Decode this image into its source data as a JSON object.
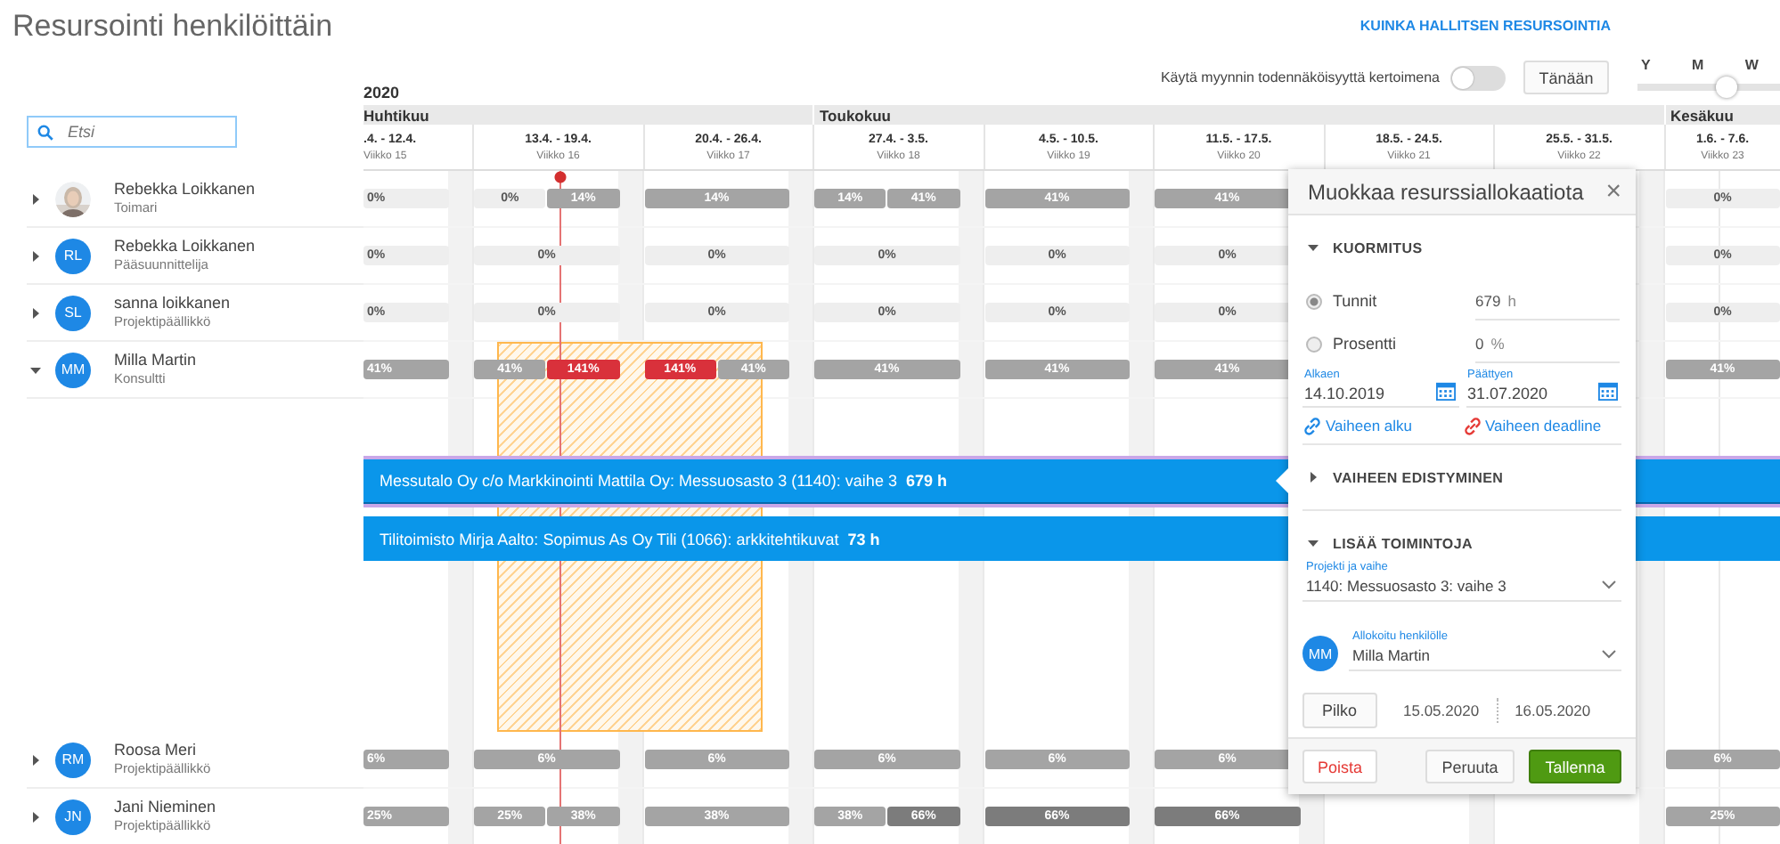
{
  "title": "Resursointi henkilöittäin",
  "help_link": "KUINKA HALLITSEN RESURSOINTIA",
  "probability_toggle": {
    "label": "Käytä myynnin todennäköisyyttä kertoimena",
    "on": false
  },
  "today_button": "Tänään",
  "zoom": {
    "labels": [
      "Y",
      "M",
      "W"
    ],
    "level": 0.62
  },
  "search": {
    "placeholder": "Etsi"
  },
  "year": "2020",
  "months": [
    {
      "name": "Huhtikuu",
      "weeks": [
        {
          "dates": ".4. - 12.4.",
          "week": "Viikko 15"
        },
        {
          "dates": "13.4. - 19.4.",
          "week": "Viikko 16"
        },
        {
          "dates": "20.4. - 26.4.",
          "week": "Viikko 17"
        }
      ]
    },
    {
      "name": "Toukokuu",
      "weeks": [
        {
          "dates": "27.4. - 3.5.",
          "week": "Viikko 18"
        },
        {
          "dates": "4.5. - 10.5.",
          "week": "Viikko 19"
        },
        {
          "dates": "11.5. - 17.5.",
          "week": "Viikko 20"
        },
        {
          "dates": "18.5. - 24.5.",
          "week": "Viikko 21"
        },
        {
          "dates": "25.5. - 31.5.",
          "week": "Viikko 22"
        }
      ]
    },
    {
      "name": "Kesäkuu",
      "weeks": [
        {
          "dates": "1.6. - 7.6.",
          "week": "Viikko 23"
        }
      ]
    }
  ],
  "people": [
    {
      "name": "Rebekka Loikkanen",
      "role": "Toimari",
      "avatar": {
        "kind": "picture"
      },
      "expanded": false,
      "weeks": [
        [
          {
            "label": "0%",
            "kind": "empty"
          }
        ],
        [
          {
            "label": "0%",
            "kind": "empty"
          },
          {
            "label": "14%",
            "kind": "normal"
          }
        ],
        [
          {
            "label": "14%",
            "kind": "normal"
          }
        ],
        [
          {
            "label": "14%",
            "kind": "normal"
          },
          {
            "label": "41%",
            "kind": "normal"
          }
        ],
        [
          {
            "label": "41%",
            "kind": "normal"
          }
        ],
        [
          {
            "label": "41%",
            "kind": "normal"
          }
        ],
        [
          {
            "label": "0%",
            "kind": "empty"
          }
        ]
      ]
    },
    {
      "name": "Rebekka Loikkanen",
      "role": "Pääsuunnittelija",
      "avatar": {
        "kind": "initials",
        "text": "RL"
      },
      "expanded": false,
      "weeks": [
        [
          {
            "label": "0%",
            "kind": "empty"
          }
        ],
        [
          {
            "label": "0%",
            "kind": "empty"
          }
        ],
        [
          {
            "label": "0%",
            "kind": "empty"
          }
        ],
        [
          {
            "label": "0%",
            "kind": "empty"
          }
        ],
        [
          {
            "label": "0%",
            "kind": "empty"
          }
        ],
        [
          {
            "label": "0%",
            "kind": "empty"
          }
        ],
        [
          {
            "label": "0%",
            "kind": "empty"
          }
        ]
      ]
    },
    {
      "name": "sanna loikkanen",
      "role": "Projektipäällikkö",
      "avatar": {
        "kind": "initials",
        "text": "SL"
      },
      "expanded": false,
      "weeks": [
        [
          {
            "label": "0%",
            "kind": "empty"
          }
        ],
        [
          {
            "label": "0%",
            "kind": "empty"
          }
        ],
        [
          {
            "label": "0%",
            "kind": "empty"
          }
        ],
        [
          {
            "label": "0%",
            "kind": "empty"
          }
        ],
        [
          {
            "label": "0%",
            "kind": "empty"
          }
        ],
        [
          {
            "label": "0%",
            "kind": "empty"
          }
        ],
        [
          {
            "label": "0%",
            "kind": "empty"
          }
        ]
      ]
    },
    {
      "name": "Milla Martin",
      "role": "Konsultti",
      "avatar": {
        "kind": "initials",
        "text": "MM"
      },
      "expanded": true,
      "weeks": [
        [
          {
            "label": "41%",
            "kind": "normal"
          }
        ],
        [
          {
            "label": "41%",
            "kind": "normal"
          },
          {
            "label": "141%",
            "kind": "over"
          }
        ],
        [
          {
            "label": "141%",
            "kind": "over"
          },
          {
            "label": "41%",
            "kind": "normal"
          }
        ],
        [
          {
            "label": "41%",
            "kind": "normal"
          }
        ],
        [
          {
            "label": "41%",
            "kind": "normal"
          }
        ],
        [
          {
            "label": "41%",
            "kind": "normal"
          }
        ],
        [
          {
            "label": "41%",
            "kind": "normal"
          }
        ]
      ],
      "allocations": [
        {
          "text": "Messutalo Oy c/o Markkinointi Mattila Oy: Messuosasto 3 (1140): vaihe 3  **679 h**",
          "selected": true
        },
        {
          "text": "Tilitoimisto Mirja Aalto: Sopimus As Oy Tili (1066): arkkitehtikuvat  **73 h**",
          "selected": false
        }
      ]
    },
    {
      "name": "Roosa Meri",
      "role": "Projektipäällikkö",
      "avatar": {
        "kind": "initials",
        "text": "RM"
      },
      "expanded": false,
      "weeks": [
        [
          {
            "label": "6%",
            "kind": "normal"
          }
        ],
        [
          {
            "label": "6%",
            "kind": "normal"
          }
        ],
        [
          {
            "label": "6%",
            "kind": "normal"
          }
        ],
        [
          {
            "label": "6%",
            "kind": "normal"
          }
        ],
        [
          {
            "label": "6%",
            "kind": "normal"
          }
        ],
        [
          {
            "label": "6%",
            "kind": "normal"
          }
        ],
        [
          {
            "label": "6%",
            "kind": "normal"
          }
        ]
      ]
    },
    {
      "name": "Jani Nieminen",
      "role": "Projektipäällikkö",
      "avatar": {
        "kind": "initials",
        "text": "JN"
      },
      "expanded": false,
      "weeks": [
        [
          {
            "label": "25%",
            "kind": "normal"
          }
        ],
        [
          {
            "label": "25%",
            "kind": "normal"
          },
          {
            "label": "38%",
            "kind": "normal"
          }
        ],
        [
          {
            "label": "38%",
            "kind": "normal"
          }
        ],
        [
          {
            "label": "38%",
            "kind": "normal"
          },
          {
            "label": "66%",
            "kind": "dark"
          }
        ],
        [
          {
            "label": "66%",
            "kind": "dark"
          }
        ],
        [
          {
            "label": "66%",
            "kind": "dark"
          }
        ],
        [
          {
            "label": "25%",
            "kind": "normal"
          }
        ]
      ]
    }
  ],
  "editor": {
    "title": "Muokkaa resurssiallokaatiota",
    "close": "×",
    "sections": [
      {
        "title": "KUORMITUS",
        "expanded": true
      },
      {
        "title": "VAIHEEN EDISTYMINEN",
        "expanded": false
      },
      {
        "title": "LISÄÄ TOIMINTOJA",
        "expanded": true
      }
    ],
    "load_modes": [
      {
        "label": "Tunnit",
        "value": "679",
        "unit": "h",
        "selected": true
      },
      {
        "label": "Prosentti",
        "value": "0",
        "unit": "%",
        "selected": false
      }
    ],
    "start": {
      "label": "Alkaen",
      "value": "14.10.2019"
    },
    "end": {
      "label": "Päättyen",
      "value": "31.07.2020"
    },
    "links": [
      {
        "label": "Vaiheen alku",
        "kind": "linked"
      },
      {
        "label": "Vaiheen deadline",
        "kind": "unlinked"
      }
    ],
    "project": {
      "label": "Projekti ja vaihe",
      "value": "1140: Messuosasto 3: vaihe 3"
    },
    "assignee": {
      "label": "Allokoitu henkilölle",
      "value": "Milla Martin",
      "initials": "MM"
    },
    "split": {
      "button": "Pilko",
      "from": "15.05.2020",
      "to": "16.05.2020"
    },
    "actions": [
      {
        "label": "Poista",
        "kind": "danger"
      },
      {
        "label": "Peruuta",
        "kind": "default"
      },
      {
        "label": "Tallenna",
        "kind": "primary"
      }
    ]
  }
}
